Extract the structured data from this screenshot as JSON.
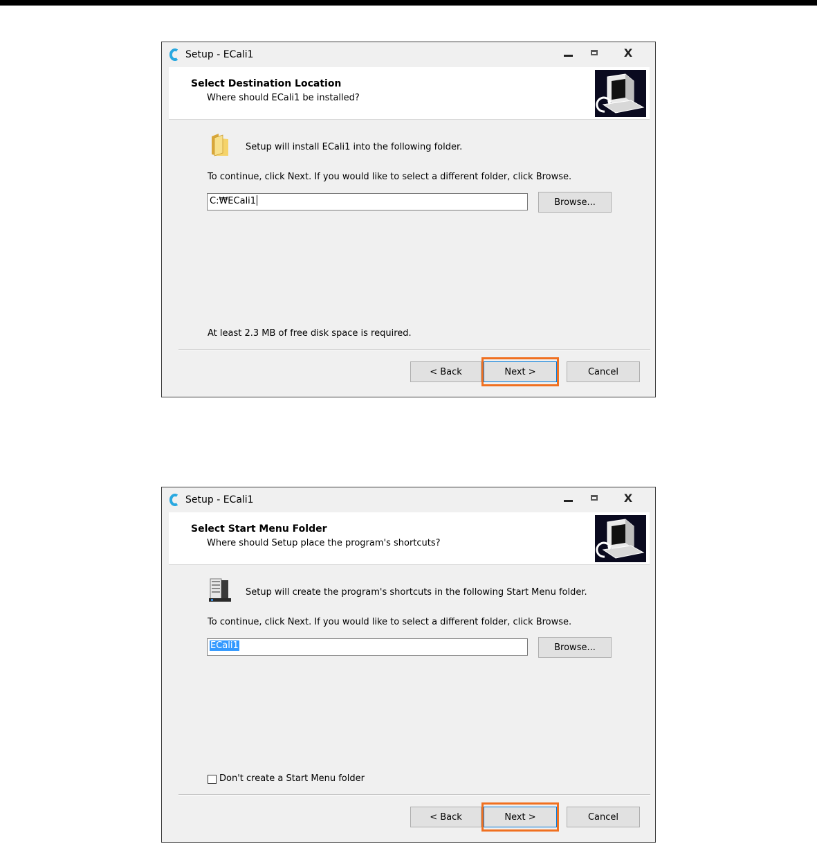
{
  "dialogs": [
    {
      "window_title": "Setup - ECali1",
      "header_title": "Select Destination Location",
      "header_subtitle": "Where should ECali1 be installed?",
      "intro_text": "Setup will install ECali1 into the following folder.",
      "continue_text": "To continue, click Next. If you would like to select a different folder, click Browse.",
      "input_value": "C:₩ECali1",
      "browse_label": "Browse...",
      "footer_text": "At least 2.3 MB of free disk space is required.",
      "back_label": "< Back",
      "next_label": "Next >",
      "cancel_label": "Cancel",
      "icon": "folder-icon"
    },
    {
      "window_title": "Setup - ECali1",
      "header_title": "Select Start Menu Folder",
      "header_subtitle": "Where should Setup place the program's shortcuts?",
      "intro_text": "Setup will create the program's shortcuts in the following Start Menu folder.",
      "continue_text": "To continue, click Next. If you would like to select a different folder, click Browse.",
      "input_value": "ECali1",
      "browse_label": "Browse...",
      "checkbox_label": "Don't create a Start Menu folder",
      "checkbox_checked": false,
      "back_label": "< Back",
      "next_label": "Next >",
      "cancel_label": "Cancel",
      "icon": "start-menu-folder-icon"
    }
  ],
  "colors": {
    "highlight": "#f07020",
    "accent": "#0078d7",
    "app_icon": "#29a8e0"
  }
}
